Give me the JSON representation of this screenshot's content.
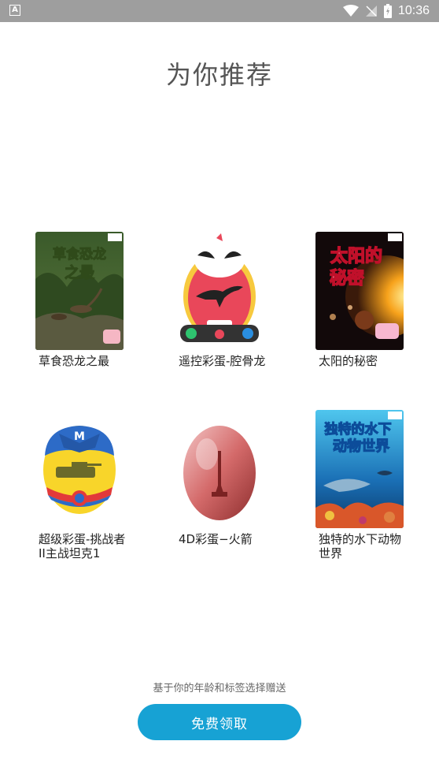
{
  "status_bar": {
    "time": "10:36"
  },
  "page": {
    "title": "为你推荐"
  },
  "items": [
    {
      "label": "草食恐龙之最",
      "cover_text": "草食恐龙之最"
    },
    {
      "label": "遥控彩蛋-腔骨龙"
    },
    {
      "label": "太阳的秘密",
      "cover_text": "太阳的秘密"
    },
    {
      "label": "超级彩蛋-挑战者II主战坦克1"
    },
    {
      "label": "4D彩蛋−火箭"
    },
    {
      "label": "独特的水下动物世界",
      "cover_text": "独特的水下动物世界"
    }
  ],
  "footer": {
    "hint": "基于你的年龄和标签选择赠送",
    "button_label": "免费领取"
  },
  "colors": {
    "accent": "#17a2d4",
    "status_bar": "#9e9e9e"
  }
}
